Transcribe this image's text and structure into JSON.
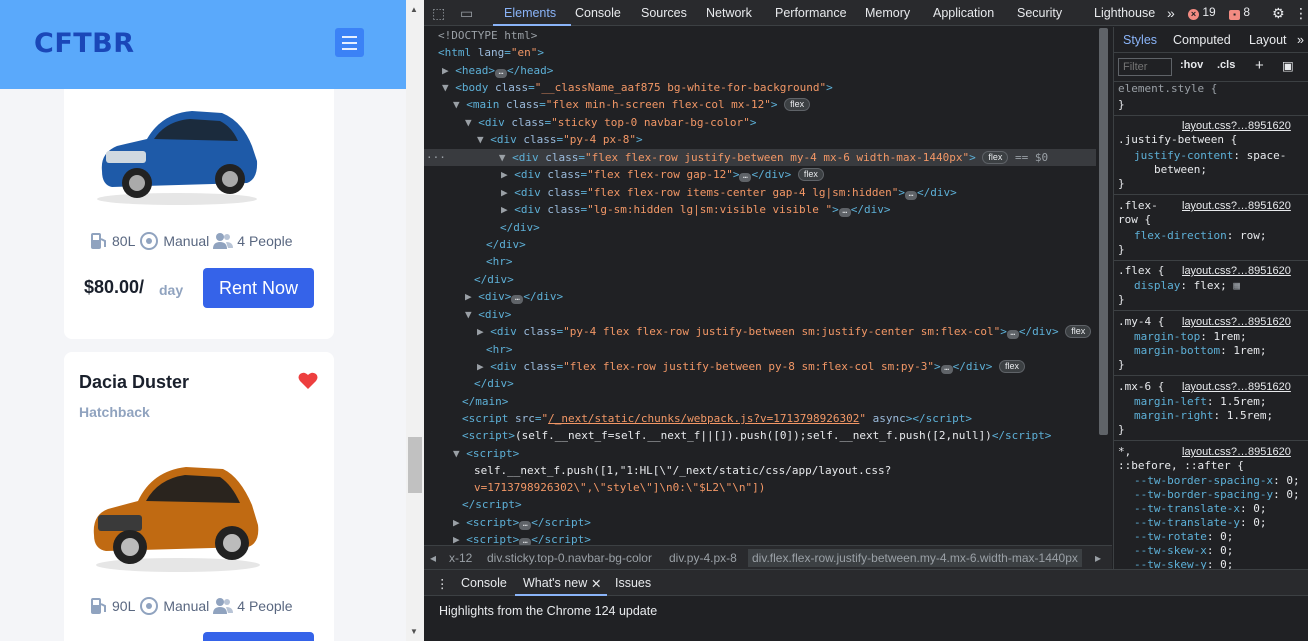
{
  "preview": {
    "brand": "CFTBR",
    "cards": [
      {
        "specs": [
          "80L",
          "Manual",
          "4 People"
        ],
        "price": "$80.00/",
        "per": "day",
        "button": "Rent Now",
        "car_color": "#1e5aa8"
      },
      {
        "title": "Dacia Duster",
        "type": "Hatchback",
        "specs": [
          "90L",
          "Manual",
          "4 People"
        ],
        "car_color": "#c06a12"
      }
    ]
  },
  "devtools": {
    "tabs": [
      "Elements",
      "Console",
      "Sources",
      "Network",
      "Performance",
      "Memory",
      "Application",
      "Security",
      "Lighthouse"
    ],
    "errors": "19",
    "warnings": "8",
    "breadcrumbs": [
      "x-12",
      "div.sticky.top-0.navbar-bg-color",
      "div.py-4.px-8",
      "div.flex.flex-row.justify-between.my-4.mx-6.width-max-1440px"
    ],
    "styles_tabs": [
      "Styles",
      "Computed",
      "Layout"
    ],
    "filter_placeholder": "Filter",
    "hov": ":hov",
    "cls": ".cls",
    "drawer_tabs": [
      "Console",
      "What's new",
      "Issues"
    ],
    "drawer_text": "Highlights from the Chrome 124 update",
    "dom": {
      "doctype": "<!DOCTYPE html>",
      "html_lang": "en",
      "body_class": "__className_aaf875 bg-white-for-background",
      "main_class": "flex min-h-screen flex-col mx-12",
      "sticky_class": "sticky top-0 navbar-bg-color",
      "py_class": "py-4 px-8",
      "sel_class": "flex flex-row justify-between my-4 mx-6 width-max-1440px",
      "sel_suffix": "== $0",
      "c1": "flex flex-row gap-12",
      "c2": "flex flex-row items-center gap-4 lg|sm:hidden",
      "c3": "lg-sm:hidden lg|sm:visible visible ",
      "c4": "py-4 flex flex-row justify-between sm:justify-center sm:flex-col",
      "c5": "flex flex-row justify-between py-8 sm:flex-col sm:py-3",
      "script_src": "/_next/static/chunks/webpack.js?v=1713798926302",
      "script_async": "async",
      "script2": "(self.__next_f=self.__next_f||[]).push([0]);self.__next_f.push([2,null])",
      "script3a": "self.__next_f.push([1,\"1:HL[\\\"/_next/static/css/app/layout.css?",
      "script3b": "v=1713798926302\\\",\\\"style\\\"]\\n0:\\\"$L2\\\"\\n\"])",
      "flex": "flex"
    },
    "rules": {
      "element_style": "element.style {",
      "src": "layout.css?…8951620",
      "r1_sel": ".justify-between {",
      "r1_prop": "justify-content",
      "r1_val": "space-",
      "r1_val2": "between;",
      "r2_sel": ".flex-",
      "r2_sel2": "row {",
      "r2_prop": "flex-direction",
      "r2_val": "row;",
      "r3_sel": ".flex {",
      "r3_prop": "display",
      "r3_val": "flex;",
      "r4_sel": ".my-4 {",
      "r4_p1": "margin-top",
      "r4_v1": "1rem;",
      "r4_p2": "margin-bottom",
      "r4_v2": "1rem;",
      "r5_sel": ".mx-6 {",
      "r5_p1": "margin-left",
      "r5_v1": "1.5rem;",
      "r5_p2": "margin-right",
      "r5_v2": "1.5rem;",
      "r6_sel": "*,",
      "r6_sel2": "::before, ::after {",
      "vars": [
        "--tw-border-spacing-x",
        "--tw-border-spacing-y",
        "--tw-translate-x",
        "--tw-translate-y",
        "--tw-rotate",
        "--tw-skew-x",
        "--tw-skew-y"
      ],
      "var_val": "0;"
    }
  }
}
